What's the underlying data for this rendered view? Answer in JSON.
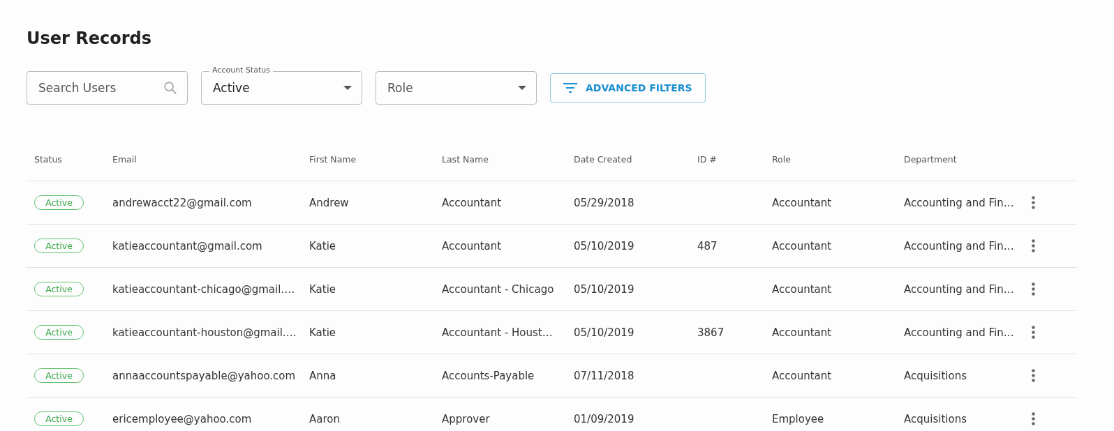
{
  "title": "User Records",
  "search": {
    "placeholder": "Search Users"
  },
  "filters": [
    {
      "label": "Account Status",
      "value": "Active"
    },
    {
      "placeholder": "Role"
    }
  ],
  "advanced_filters_button": "ADVANCED FILTERS",
  "table": {
    "columns": [
      "Status",
      "Email",
      "First Name",
      "Last Name",
      "Date Created",
      "ID #",
      "Role",
      "Department"
    ],
    "rows": [
      {
        "status": "Active",
        "email": "andrewacct22@gmail.com",
        "first_name": "Andrew",
        "last_name": "Accountant",
        "date_created": "05/29/2018",
        "id": "",
        "role": "Accountant",
        "department": "Accounting and Fin…"
      },
      {
        "status": "Active",
        "email": "katieaccountant@gmail.com",
        "first_name": "Katie",
        "last_name": "Accountant",
        "date_created": "05/10/2019",
        "id": "487",
        "role": "Accountant",
        "department": "Accounting and Fin…"
      },
      {
        "status": "Active",
        "email": "katieaccountant-chicago@gmail.…",
        "first_name": "Katie",
        "last_name": "Accountant - Chicago",
        "date_created": "05/10/2019",
        "id": "",
        "role": "Accountant",
        "department": "Accounting and Fin…"
      },
      {
        "status": "Active",
        "email": "katieaccountant-houston@gmail.…",
        "first_name": "Katie",
        "last_name": "Accountant - Houst…",
        "date_created": "05/10/2019",
        "id": "3867",
        "role": "Accountant",
        "department": "Accounting and Fin…"
      },
      {
        "status": "Active",
        "email": "annaaccountspayable@yahoo.com",
        "first_name": "Anna",
        "last_name": "Accounts-Payable",
        "date_created": "07/11/2018",
        "id": "",
        "role": "Accountant",
        "department": "Acquisitions"
      },
      {
        "status": "Active",
        "email": "ericemployee@yahoo.com",
        "first_name": "Aaron",
        "last_name": "Approver",
        "date_created": "01/09/2019",
        "id": "",
        "role": "Employee",
        "department": "Acquisitions"
      }
    ]
  }
}
